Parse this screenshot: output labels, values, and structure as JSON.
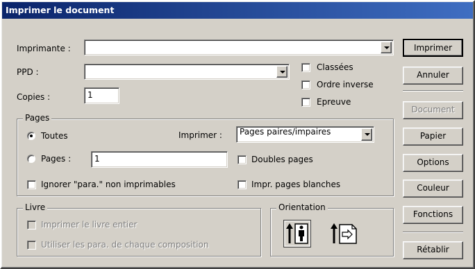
{
  "window": {
    "title": "Imprimer le document"
  },
  "printer": {
    "label": "Imprimante :",
    "value": ""
  },
  "ppd": {
    "label": "PPD :",
    "value": ""
  },
  "copies": {
    "label": "Copies :",
    "value": "1"
  },
  "options": {
    "collate": {
      "label": "Classées",
      "checked": false
    },
    "reverse": {
      "label": "Ordre inverse",
      "checked": false
    },
    "proof": {
      "label": "Epreuve",
      "checked": false
    }
  },
  "pages": {
    "legend": "Pages",
    "all_label": "Toutes",
    "range_label": "Pages :",
    "range_value": "1",
    "print_label": "Imprimer :",
    "print_value": "Pages paires/impaires",
    "spreads_label": "Doubles pages",
    "ignore_label": "Ignorer \"para.\" non imprimables",
    "blank_label": "Impr. pages blanches",
    "selected": "all"
  },
  "book": {
    "legend": "Livre",
    "print_book_label": "Imprimer le livre entier",
    "use_para_label": "Utiliser les para. de chaque composition"
  },
  "orientation": {
    "legend": "Orientation",
    "portrait_icon": "portrait-orientation-icon",
    "landscape_icon": "landscape-orientation-icon"
  },
  "buttons": {
    "print": "Imprimer",
    "cancel": "Annuler",
    "document": "Document",
    "paper": "Papier",
    "options": "Options",
    "color": "Couleur",
    "functions": "Fonctions",
    "reset": "Rétablir"
  }
}
